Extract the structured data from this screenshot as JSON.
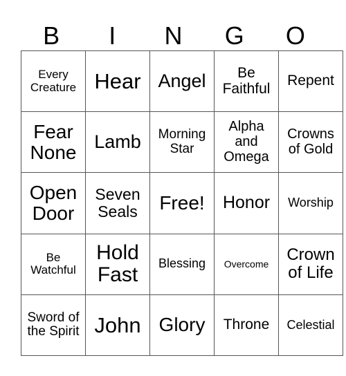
{
  "header": [
    "B",
    "I",
    "N",
    "G",
    "O"
  ],
  "cells": [
    [
      {
        "text": "Every Creature",
        "size": 17
      },
      {
        "text": "Hear",
        "size": 31
      },
      {
        "text": "Angel",
        "size": 27
      },
      {
        "text": "Be Faithful",
        "size": 21
      },
      {
        "text": "Repent",
        "size": 21
      }
    ],
    [
      {
        "text": "Fear None",
        "size": 28
      },
      {
        "text": "Lamb",
        "size": 27
      },
      {
        "text": "Morning Star",
        "size": 19
      },
      {
        "text": "Alpha and Omega",
        "size": 20
      },
      {
        "text": "Crowns of Gold",
        "size": 20
      }
    ],
    [
      {
        "text": "Open Door",
        "size": 28
      },
      {
        "text": "Seven Seals",
        "size": 23
      },
      {
        "text": "Free!",
        "size": 28
      },
      {
        "text": "Honor",
        "size": 25
      },
      {
        "text": "Worship",
        "size": 18
      }
    ],
    [
      {
        "text": "Be Watchful",
        "size": 17
      },
      {
        "text": "Hold Fast",
        "size": 30
      },
      {
        "text": "Blessing",
        "size": 18
      },
      {
        "text": "Overcome",
        "size": 14
      },
      {
        "text": "Crown of Life",
        "size": 24
      }
    ],
    [
      {
        "text": "Sword of the Spirit",
        "size": 19
      },
      {
        "text": "John",
        "size": 31
      },
      {
        "text": "Glory",
        "size": 28
      },
      {
        "text": "Throne",
        "size": 21
      },
      {
        "text": "Celestial",
        "size": 18
      }
    ]
  ]
}
